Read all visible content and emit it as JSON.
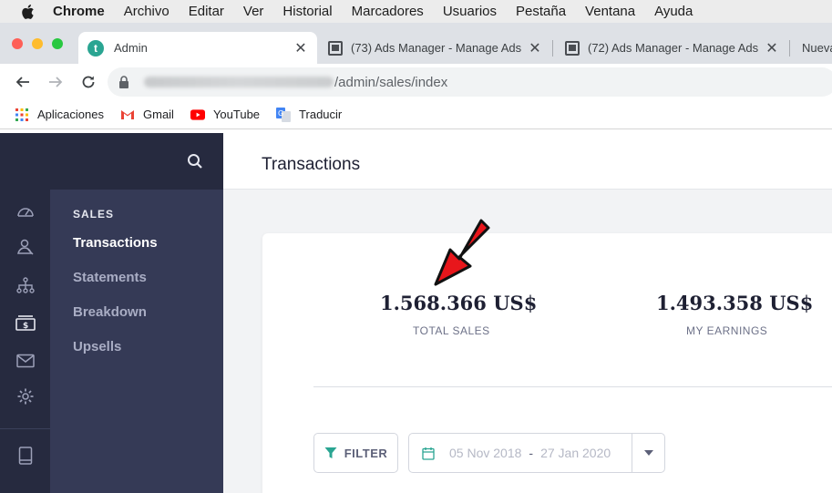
{
  "menubar": {
    "app": "Chrome",
    "items": [
      "Archivo",
      "Editar",
      "Ver",
      "Historial",
      "Marcadores",
      "Usuarios",
      "Pestaña",
      "Ventana",
      "Ayuda"
    ]
  },
  "tabs": [
    {
      "title": "Admin"
    },
    {
      "title": "(73) Ads Manager - Manage Ads"
    },
    {
      "title": "(72) Ads Manager - Manage Ads"
    },
    {
      "title": "Nueva"
    }
  ],
  "address": {
    "path": "/admin/sales/index"
  },
  "bookmarks": [
    "Aplicaciones",
    "Gmail",
    "YouTube",
    "Traducir"
  ],
  "sidebar": {
    "section": "SALES",
    "items": [
      {
        "label": "Transactions",
        "active": true
      },
      {
        "label": "Statements"
      },
      {
        "label": "Breakdown"
      },
      {
        "label": "Upsells"
      }
    ]
  },
  "main": {
    "title": "Transactions",
    "stats": [
      {
        "value": "1.568.366 US$",
        "label": "TOTAL SALES"
      },
      {
        "value": "1.493.358 US$",
        "label": "MY EARNINGS"
      }
    ],
    "filter_label": "FILTER",
    "date_from": "05 Nov 2018",
    "date_to": "27 Jan 2020",
    "date_sep": "-"
  },
  "colors": {
    "sidebar_dark": "#262a3f",
    "sidebar_sub": "#353a56",
    "favicon": "#2aa592",
    "annotation_arrow": "#e8161b"
  }
}
